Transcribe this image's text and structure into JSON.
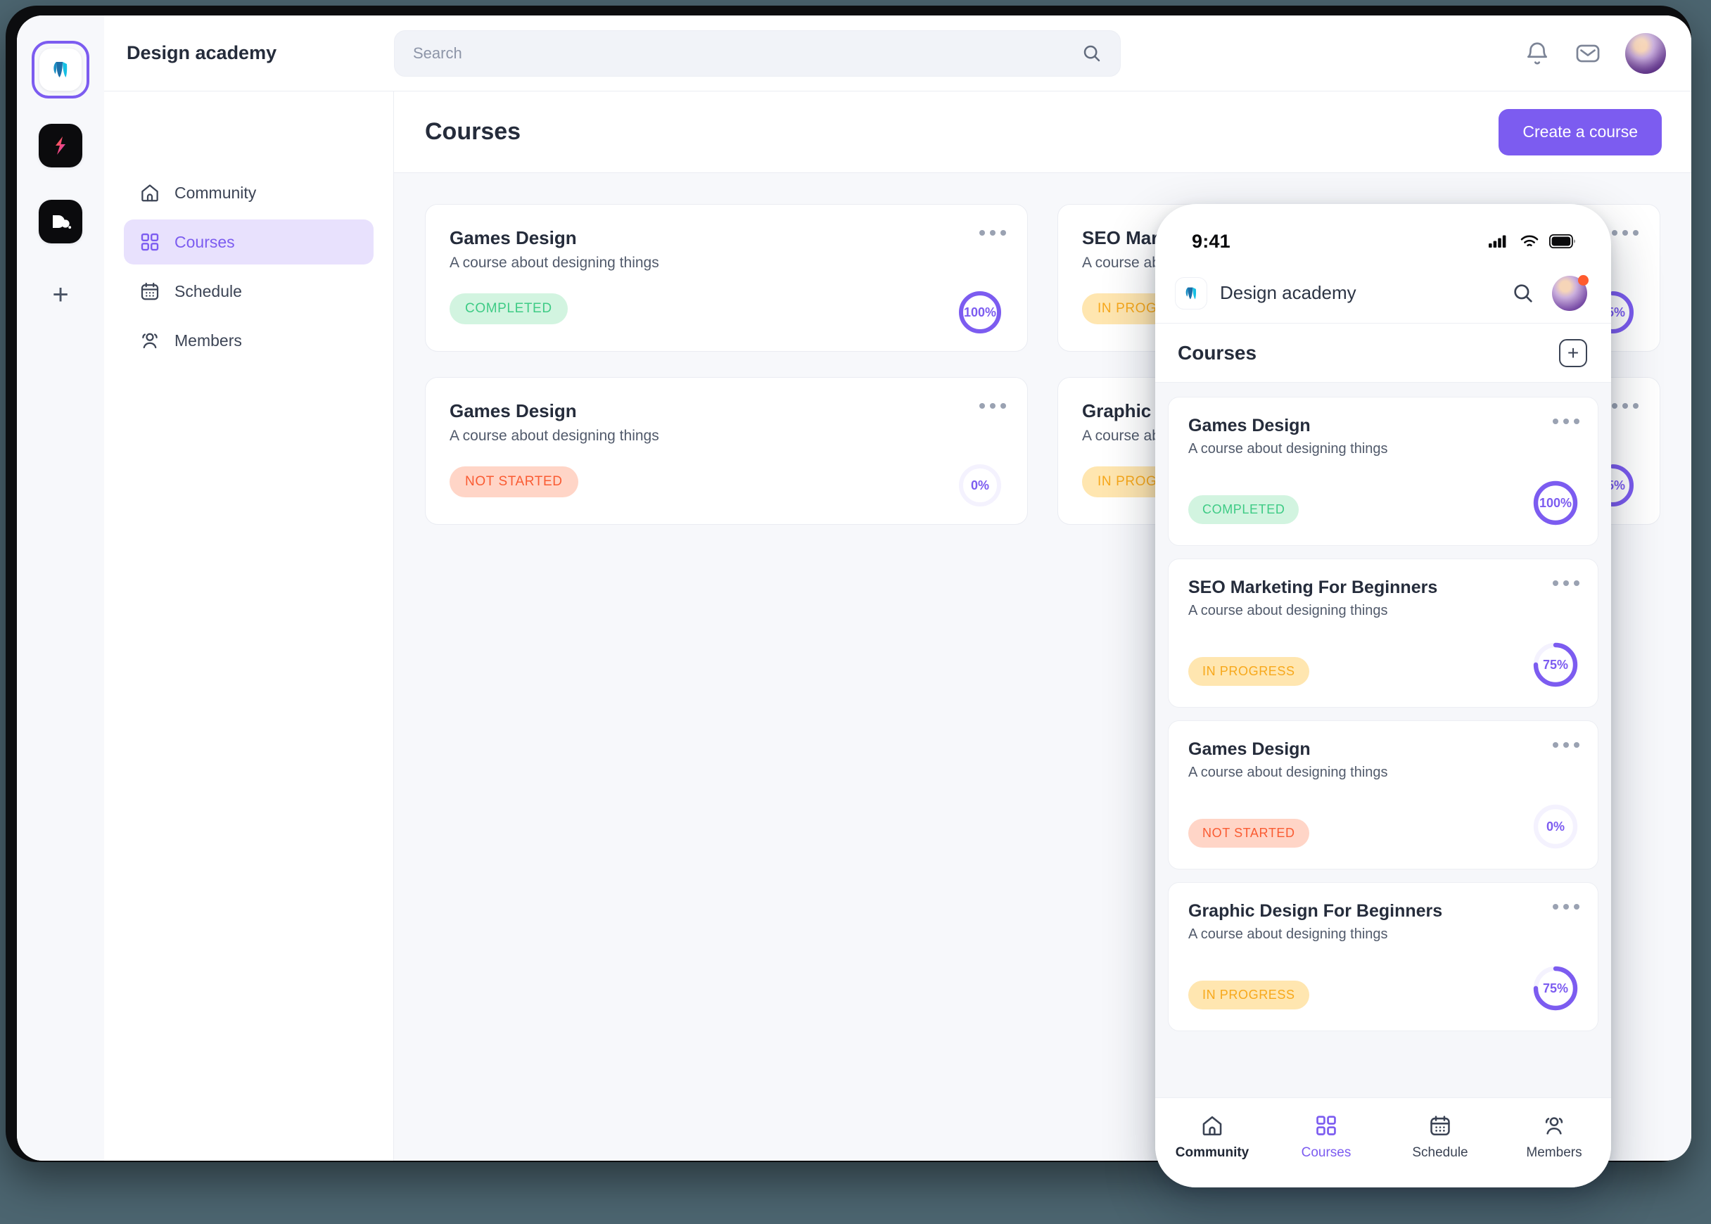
{
  "theme": {
    "accent": "#7c5cf0",
    "accent_soft": "#e8e1fd",
    "page_bg": "#f7f8fb",
    "desktop_bg": "#4c6570",
    "status_completed_bg": "#d2f4e0",
    "status_completed_fg": "#3ecb85",
    "status_notstarted_bg": "#ffd5c7",
    "status_notstarted_fg": "#fa5b32",
    "status_inprogress_bg": "#ffe6b0",
    "status_inprogress_fg": "#f7a81b"
  },
  "workspaces": [
    {
      "name": "design-academy",
      "icon": "leaf-logo",
      "active": true
    },
    {
      "name": "bolt-workspace",
      "icon": "bolt-logo",
      "active": false
    },
    {
      "name": "dot-workspace",
      "icon": "d-dot-logo",
      "active": false
    }
  ],
  "add_workspace_label": "+",
  "topbar": {
    "org_title": "Design academy",
    "search_placeholder": "Search",
    "search_value": "",
    "search_icon": "search-icon",
    "notifications_icon": "bell-icon",
    "messages_icon": "envelope-icon",
    "avatar": "user-avatar"
  },
  "sidebar": {
    "items": [
      {
        "label": "Community",
        "icon": "home-icon",
        "active": false
      },
      {
        "label": "Courses",
        "icon": "grid-icon",
        "active": true
      },
      {
        "label": "Schedule",
        "icon": "calendar-icon",
        "active": false
      },
      {
        "label": "Members",
        "icon": "people-icon",
        "active": false
      }
    ]
  },
  "content": {
    "page_title": "Courses",
    "create_button": "Create a course",
    "courses": [
      {
        "title": "Games Design",
        "description": "A course about designing things",
        "status": "COMPLETED",
        "status_kind": "completed",
        "progress": 100,
        "progress_label": "100%"
      },
      {
        "title": "SEO Marketing For Beginners",
        "description": "A course about designing things",
        "status": "IN PROGRESS",
        "status_kind": "inprogress",
        "progress": 75,
        "progress_label": "75%"
      },
      {
        "title": "Games Design",
        "description": "A course about designing things",
        "status": "NOT STARTED",
        "status_kind": "notstarted",
        "progress": 0,
        "progress_label": "0%"
      },
      {
        "title": "Graphic Design For Beginners",
        "description": "A course about designing things",
        "status": "IN PROGRESS",
        "status_kind": "inprogress",
        "progress": 75,
        "progress_label": "75%"
      }
    ]
  },
  "phone": {
    "status_bar": {
      "time": "9:41",
      "signal_icon": "cellular-signal-icon",
      "wifi_icon": "wifi-icon",
      "battery_icon": "battery-full-icon"
    },
    "header": {
      "logo": "leaf-logo",
      "org_title": "Design academy",
      "search_icon": "search-icon",
      "avatar": "user-avatar",
      "avatar_badge": "unread-dot"
    },
    "section": {
      "title": "Courses",
      "add_label": "+"
    },
    "courses": [
      {
        "title": "Games Design",
        "description": "A course about designing things",
        "status": "COMPLETED",
        "status_kind": "completed",
        "progress": 100,
        "progress_label": "100%"
      },
      {
        "title": "SEO Marketing For Beginners",
        "description": "A course about designing things",
        "status": "IN PROGRESS",
        "status_kind": "inprogress",
        "progress": 75,
        "progress_label": "75%"
      },
      {
        "title": "Games Design",
        "description": "A course about designing things",
        "status": "NOT STARTED",
        "status_kind": "notstarted",
        "progress": 0,
        "progress_label": "0%"
      },
      {
        "title": "Graphic Design For Beginners",
        "description": "A course about designing things",
        "status": "IN PROGRESS",
        "status_kind": "inprogress",
        "progress": 75,
        "progress_label": "75%"
      }
    ],
    "tabs": [
      {
        "label": "Community",
        "icon": "home-icon",
        "active": false,
        "emphasis": true
      },
      {
        "label": "Courses",
        "icon": "grid-icon",
        "active": true,
        "emphasis": false
      },
      {
        "label": "Schedule",
        "icon": "calendar-icon",
        "active": false,
        "emphasis": false
      },
      {
        "label": "Members",
        "icon": "people-icon",
        "active": false,
        "emphasis": false
      }
    ]
  }
}
